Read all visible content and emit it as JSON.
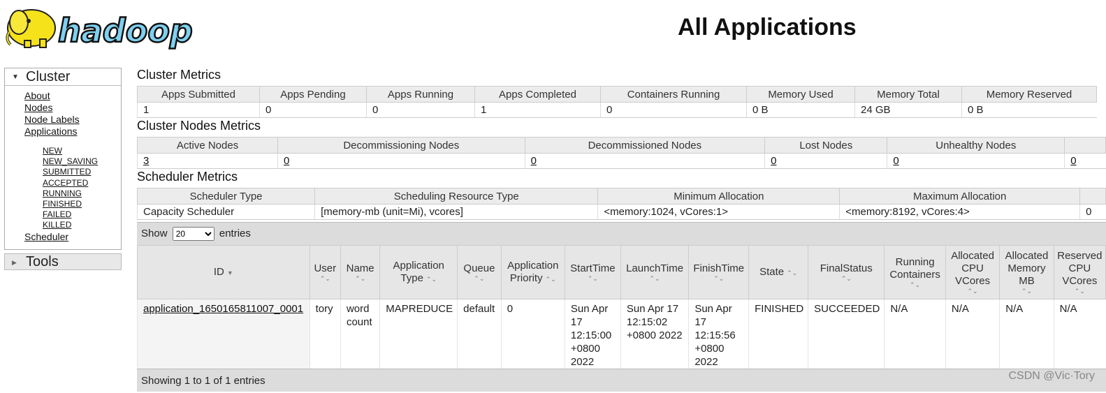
{
  "header": {
    "title": "All Applications",
    "logo_text": "hadoop"
  },
  "sidebar": {
    "cluster_label": "Cluster",
    "links": [
      "About",
      "Nodes",
      "Node Labels",
      "Applications"
    ],
    "app_states": [
      "NEW",
      "NEW_SAVING",
      "SUBMITTED",
      "ACCEPTED",
      "RUNNING",
      "FINISHED",
      "FAILED",
      "KILLED"
    ],
    "scheduler_link": "Scheduler",
    "tools_label": "Tools"
  },
  "cluster_metrics": {
    "title": "Cluster Metrics",
    "headers": [
      "Apps Submitted",
      "Apps Pending",
      "Apps Running",
      "Apps Completed",
      "Containers Running",
      "Memory Used",
      "Memory Total",
      "Memory Reserved"
    ],
    "values": [
      "1",
      "0",
      "0",
      "1",
      "0",
      "0 B",
      "24 GB",
      "0 B"
    ]
  },
  "nodes_metrics": {
    "title": "Cluster Nodes Metrics",
    "headers": [
      "Active Nodes",
      "Decommissioning Nodes",
      "Decommissioned Nodes",
      "Lost Nodes",
      "Unhealthy Nodes",
      ""
    ],
    "values": [
      "3",
      "0",
      "0",
      "0",
      "0",
      "0"
    ]
  },
  "scheduler_metrics": {
    "title": "Scheduler Metrics",
    "headers": [
      "Scheduler Type",
      "Scheduling Resource Type",
      "Minimum Allocation",
      "Maximum Allocation",
      ""
    ],
    "values": [
      "Capacity Scheduler",
      "[memory-mb (unit=Mi), vcores]",
      "<memory:1024, vCores:1>",
      "<memory:8192, vCores:4>",
      "0"
    ]
  },
  "apps": {
    "show_label": "Show",
    "entries_label": "entries",
    "page_size": "20",
    "headers": [
      "ID",
      "User",
      "Name",
      "Application Type",
      "Queue",
      "Application Priority",
      "StartTime",
      "LaunchTime",
      "FinishTime",
      "State",
      "FinalStatus",
      "Running Containers",
      "Allocated CPU VCores",
      "Allocated Memory MB",
      "Reserved CPU VCores"
    ],
    "rows": [
      [
        "application_1650165811007_0001",
        "tory",
        "word count",
        "MAPREDUCE",
        "default",
        "0",
        "Sun Apr 17 12:15:00 +0800 2022",
        "Sun Apr 17 12:15:02 +0800 2022",
        "Sun Apr 17 12:15:56 +0800 2022",
        "FINISHED",
        "SUCCEEDED",
        "N/A",
        "N/A",
        "N/A",
        "N/A"
      ]
    ],
    "footer": "Showing 1 to 1 of 1 entries"
  },
  "watermark": "CSDN @Vic·Tory",
  "colors": {
    "logo_yellow": "#f5e21b",
    "logo_blue": "#7fd0f0",
    "header_bg": "#ececec"
  }
}
